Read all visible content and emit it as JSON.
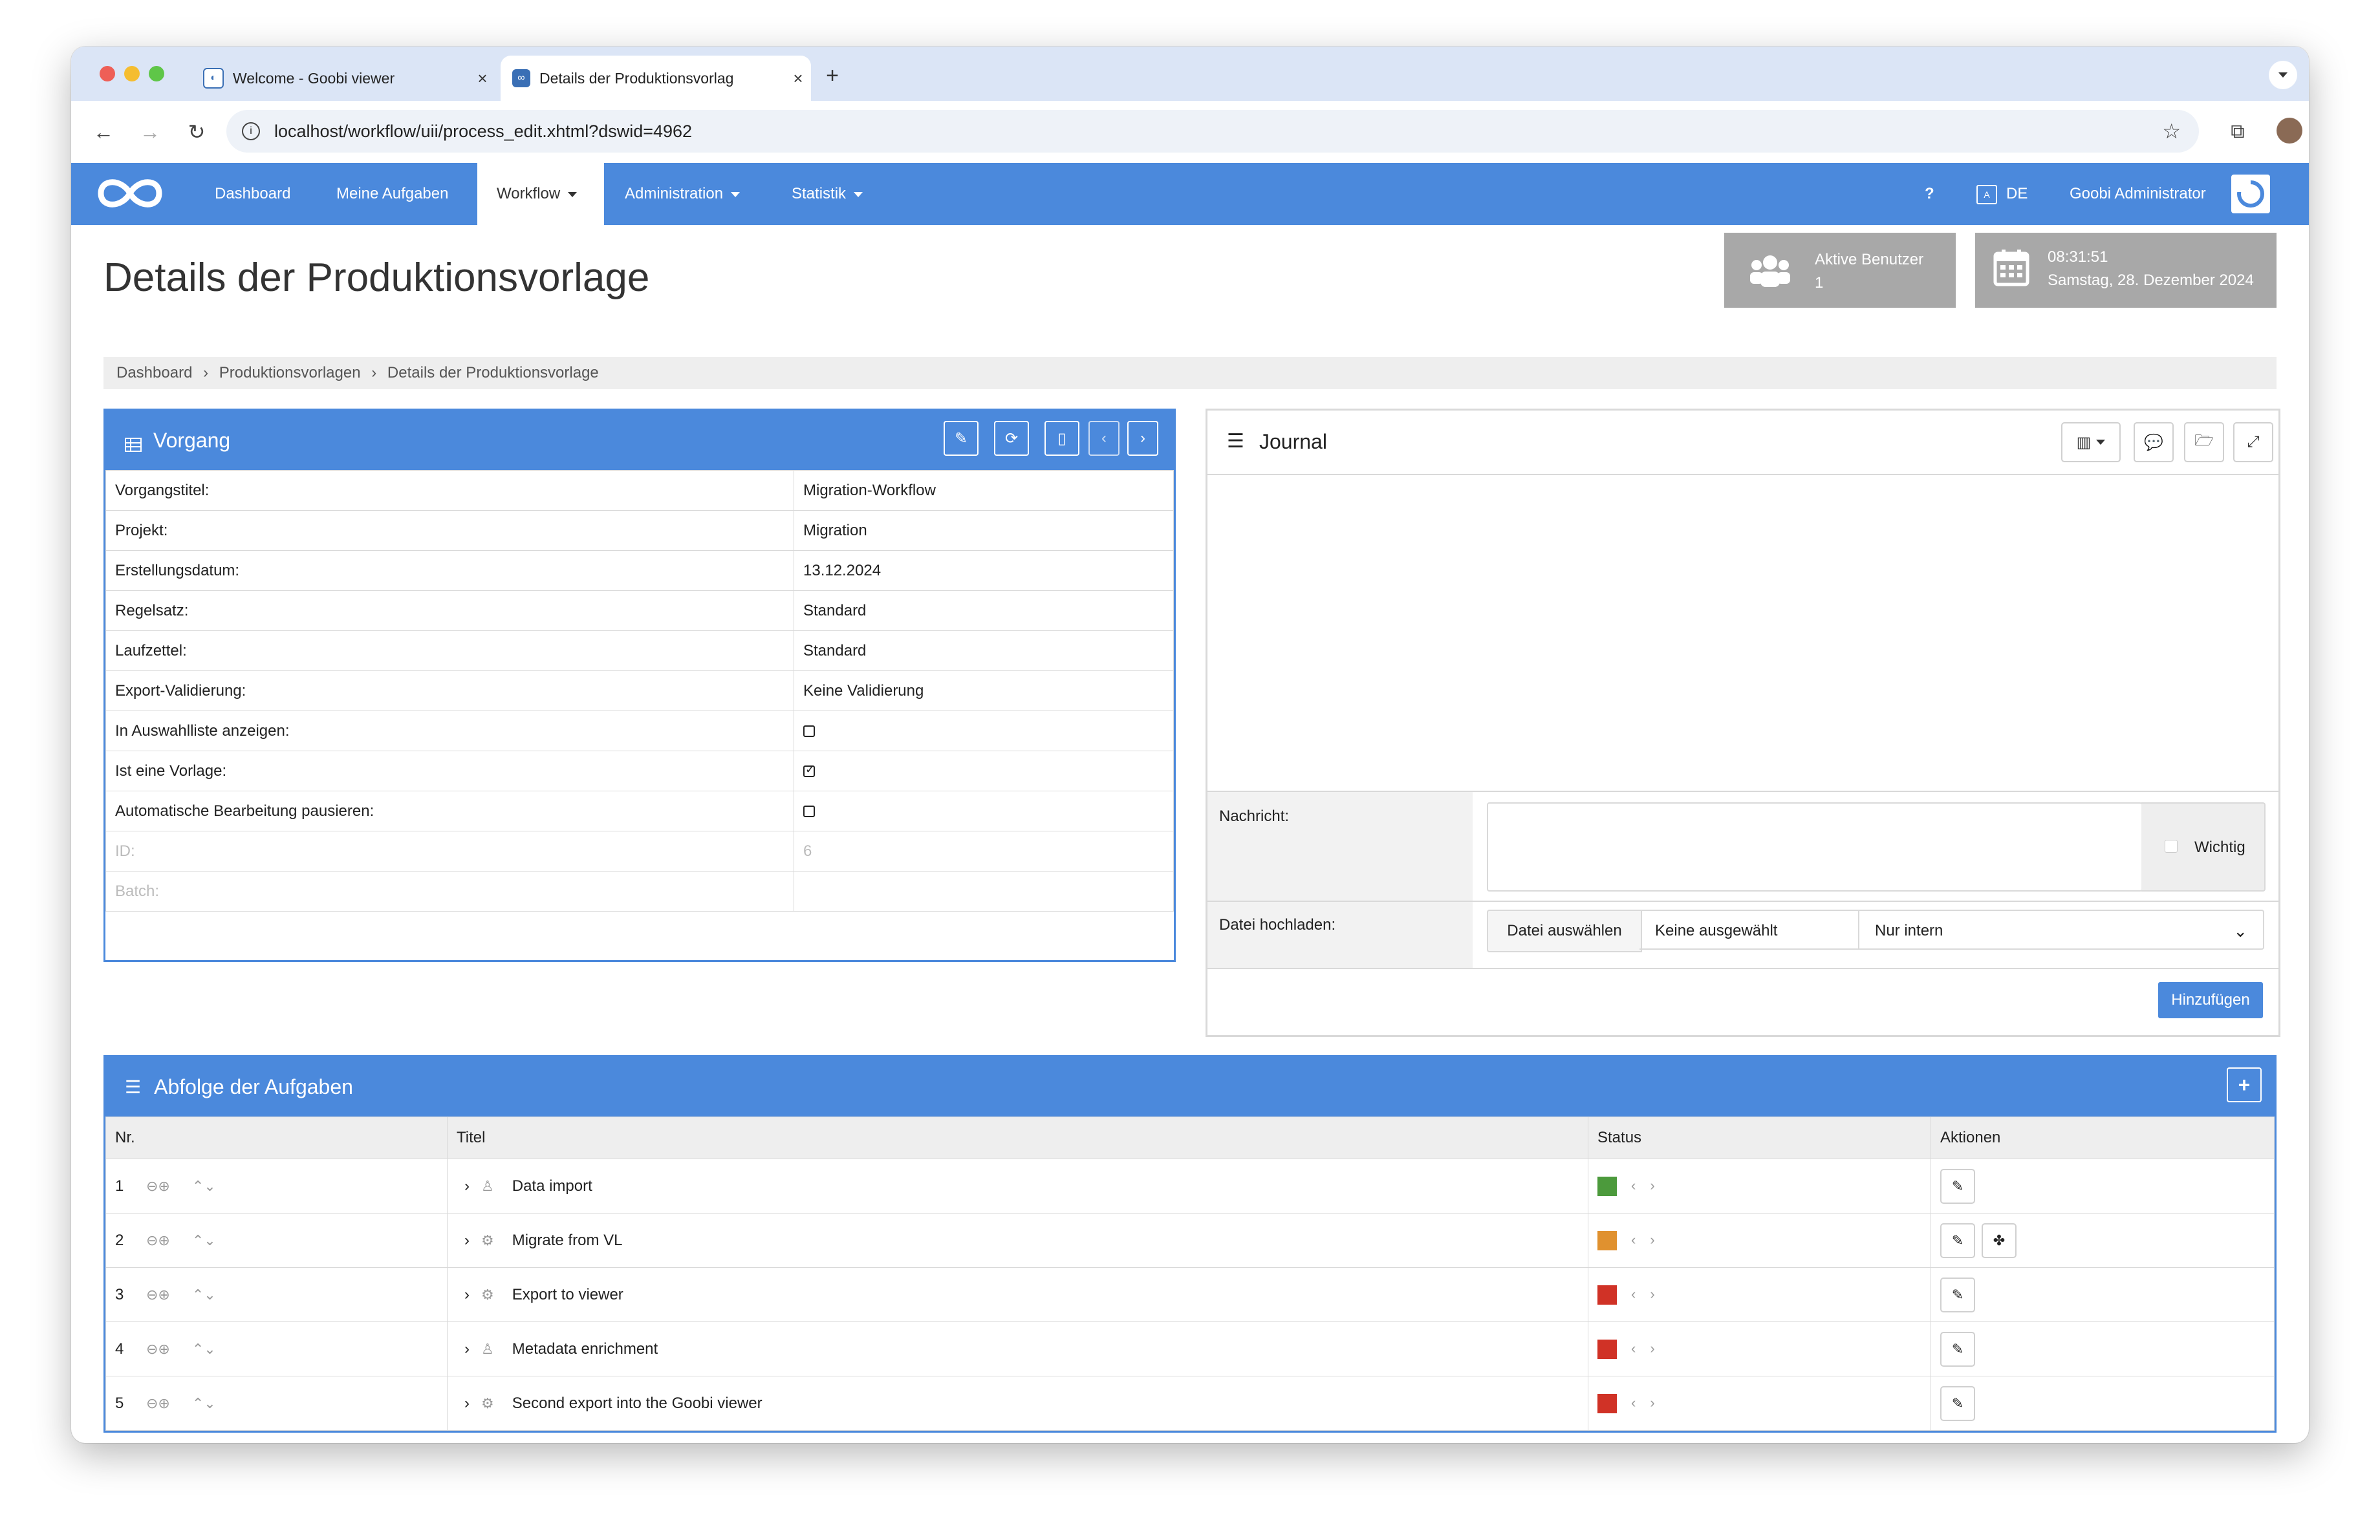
{
  "browser": {
    "tabs": [
      {
        "title": "Welcome - Goobi viewer",
        "active": false
      },
      {
        "title": "Details der Produktionsvorlag",
        "active": true
      }
    ],
    "url": "localhost/workflow/uii/process_edit.xhtml?dswid=4962"
  },
  "nav": {
    "items": [
      "Dashboard",
      "Meine Aufgaben",
      "Workflow",
      "Administration",
      "Statistik"
    ],
    "help": "?",
    "lang": "DE",
    "user": "Goobi Administrator"
  },
  "header": {
    "title": "Details der Produktionsvorlage",
    "users_label": "Aktive Benutzer",
    "users_count": "1",
    "time": "08:31:51",
    "date": "Samstag, 28. Dezember 2024"
  },
  "breadcrumb": [
    "Dashboard",
    "Produktionsvorlagen",
    "Details der Produktionsvorlage"
  ],
  "vorgang": {
    "title": "Vorgang",
    "rows": [
      {
        "label": "Vorgangstitel:",
        "value": "Migration-Workflow"
      },
      {
        "label": "Projekt:",
        "value": "Migration"
      },
      {
        "label": "Erstellungsdatum:",
        "value": "13.12.2024"
      },
      {
        "label": "Regelsatz:",
        "value": "Standard"
      },
      {
        "label": "Laufzettel:",
        "value": "Standard"
      },
      {
        "label": "Export-Validierung:",
        "value": "Keine Validierung"
      },
      {
        "label": "In Auswahlliste anzeigen:",
        "checked": false
      },
      {
        "label": "Ist eine Vorlage:",
        "checked": true
      },
      {
        "label": "Automatische Bearbeitung pausieren:",
        "checked": false
      },
      {
        "label": "ID:",
        "value": "6"
      },
      {
        "label": "Batch:",
        "value": ""
      }
    ]
  },
  "journal": {
    "title": "Journal",
    "message_label": "Nachricht:",
    "important_label": "Wichtig",
    "upload_label": "Datei hochladen:",
    "choose_file": "Datei auswählen",
    "no_file": "Keine ausgewählt",
    "visibility": "Nur intern",
    "add_button": "Hinzufügen"
  },
  "tasks": {
    "title": "Abfolge der Aufgaben",
    "columns": [
      "Nr.",
      "Titel",
      "Status",
      "Aktionen"
    ],
    "rows": [
      {
        "nr": "1",
        "title": "Data import",
        "icon": "user-icon",
        "status_color": "#4c9a3c",
        "plugin": false
      },
      {
        "nr": "2",
        "title": "Migrate from VL",
        "icon": "cogs-icon",
        "status_color": "#e0912f",
        "plugin": true
      },
      {
        "nr": "3",
        "title": "Export to viewer",
        "icon": "cogs-icon",
        "status_color": "#d03226",
        "plugin": false
      },
      {
        "nr": "4",
        "title": "Metadata enrichment",
        "icon": "user-icon",
        "status_color": "#d03226",
        "plugin": false
      },
      {
        "nr": "5",
        "title": "Second export into the Goobi viewer",
        "icon": "cogs-icon",
        "status_color": "#d03226",
        "plugin": false
      }
    ]
  },
  "colors": {
    "brand": "#4b89dc",
    "info_box": "#a8a8a8"
  }
}
